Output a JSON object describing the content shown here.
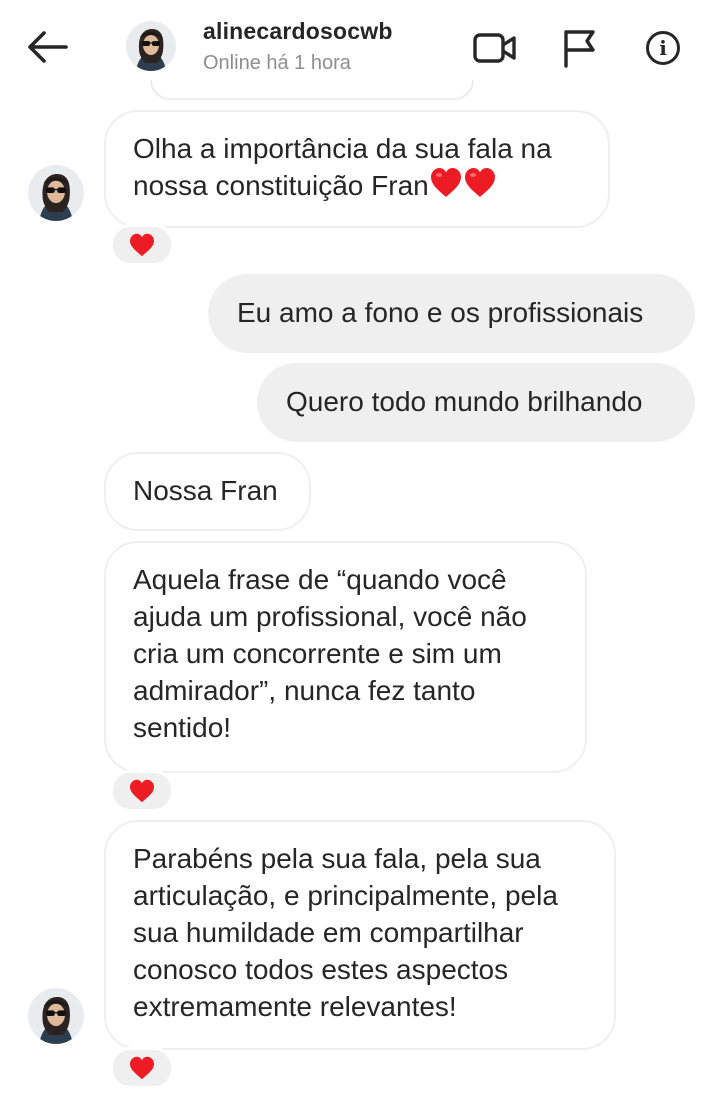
{
  "header": {
    "username": "alinecardosocwb",
    "status": "Online há 1 hora",
    "icons": {
      "back": "back-arrow-icon",
      "video": "video-camera-icon",
      "flag": "flag-icon",
      "info": "info-icon"
    },
    "info_glyph": "i"
  },
  "messages": [
    {
      "direction": "incoming",
      "text": "Olha a importância da sua fala na\nnossa constituição Fran",
      "emoji": "two red hearts",
      "reaction": "red-heart"
    },
    {
      "direction": "outgoing",
      "text": "Eu amo a fono e os profissionais"
    },
    {
      "direction": "outgoing",
      "text": "Quero todo mundo brilhando"
    },
    {
      "direction": "incoming",
      "text": "Nossa Fran"
    },
    {
      "direction": "incoming",
      "text": "Aquela frase de “quando você\najuda um profissional, você não\ncria um concorrente e sim um\nadmirador”, nunca fez tanto\nsentido!",
      "reaction": "red-heart"
    },
    {
      "direction": "incoming",
      "text": "Parabéns pela sua fala, pela sua\narticulação, e principalmente, pela\nsua humildade em compartilhar\nconosco todos estes aspectos\nextremamente relevantes!",
      "reaction": "red-heart"
    }
  ],
  "colors": {
    "heart": "#ed1c24",
    "outgoing_bubble": "#efefef",
    "incoming_border": "#efefef",
    "text": "#262626",
    "secondary_text": "#8e8e8e"
  }
}
